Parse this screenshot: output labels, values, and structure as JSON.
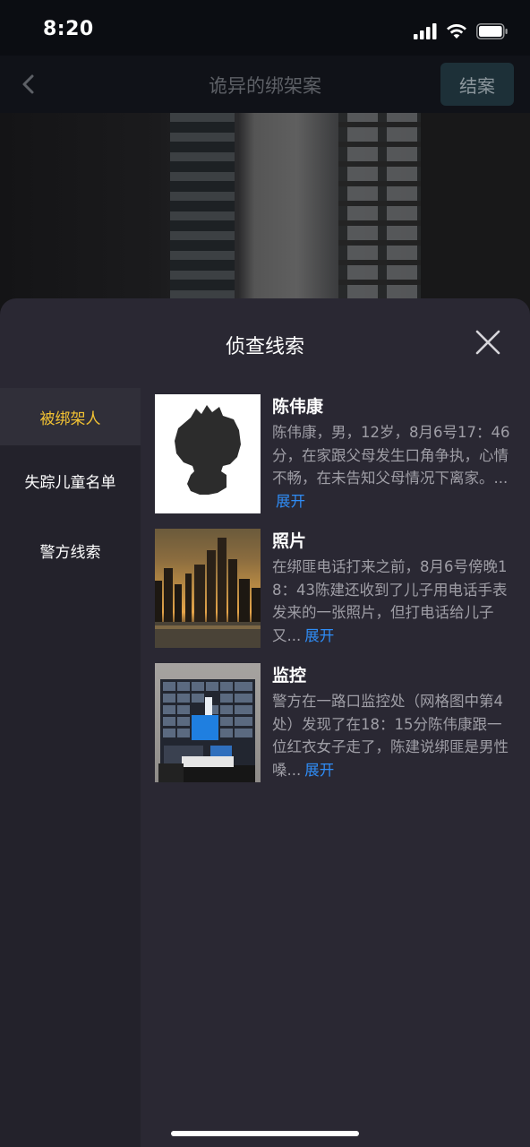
{
  "status_bar": {
    "time": "8:20"
  },
  "nav": {
    "title": "诡异的绑架案",
    "close_case_label": "结案"
  },
  "sheet": {
    "title": "侦查线索",
    "menu": [
      {
        "label": "被绑架人",
        "active": true
      },
      {
        "label": "失踪儿童名单",
        "active": false
      },
      {
        "label": "警方线索",
        "active": false
      }
    ],
    "clues": [
      {
        "title": "陈伟康",
        "desc": "陈伟康，男，12岁，8月6号17：46分，在家跟父母发生口角争执，心情不畅，在未告知父母情况下离家。...",
        "more": "展开",
        "thumb": "silhouette-avatar"
      },
      {
        "title": "照片",
        "desc": "在绑匪电话打来之前，8月6号傍晚18：43陈建还收到了儿子用电话手表发来的一张照片，但打电话给儿子又...",
        "more": "展开",
        "thumb": "city-sunset-photo"
      },
      {
        "title": "监控",
        "desc": "警方在一路口监控处（网格图中第4处）发现了在18：15分陈伟康跟一位红衣女子走了，陈建说绑匪是男性嗓...",
        "more": "展开",
        "thumb": "surveillance-monitors-photo"
      }
    ]
  },
  "colors": {
    "active_tab": "#f2c233",
    "link": "#2f8cf5",
    "sheet_bg": "#2a2833",
    "menu_bg": "#23222b"
  }
}
